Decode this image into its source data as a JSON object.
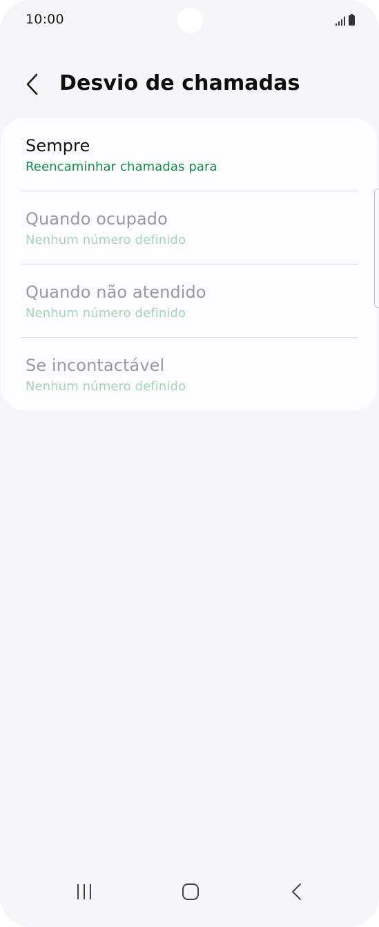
{
  "status_bar": {
    "time": "10:00",
    "icons": [
      "signal-icon",
      "battery-icon"
    ]
  },
  "header": {
    "title": "Desvio de chamadas",
    "back_icon": "chevron-left-icon"
  },
  "options": [
    {
      "title": "Sempre",
      "subtitle": "Reencaminhar chamadas para",
      "enabled": true
    },
    {
      "title": "Quando ocupado",
      "subtitle": "Nenhum número definido",
      "enabled": false
    },
    {
      "title": "Quando não atendido",
      "subtitle": "Nenhum número definido",
      "enabled": false
    },
    {
      "title": "Se incontactável",
      "subtitle": "Nenhum número definido",
      "enabled": false
    }
  ],
  "navigation": {
    "recent_icon": "recent-apps-icon",
    "home_icon": "home-icon",
    "back_icon": "back-icon"
  },
  "colors": {
    "enabled_title": "#121212",
    "enabled_subtitle": "#138a45",
    "disabled_title": "#9a9a9c",
    "disabled_subtitle": "#a6d4b7",
    "background": "#f6f6f8",
    "card": "#fcfcfe"
  }
}
